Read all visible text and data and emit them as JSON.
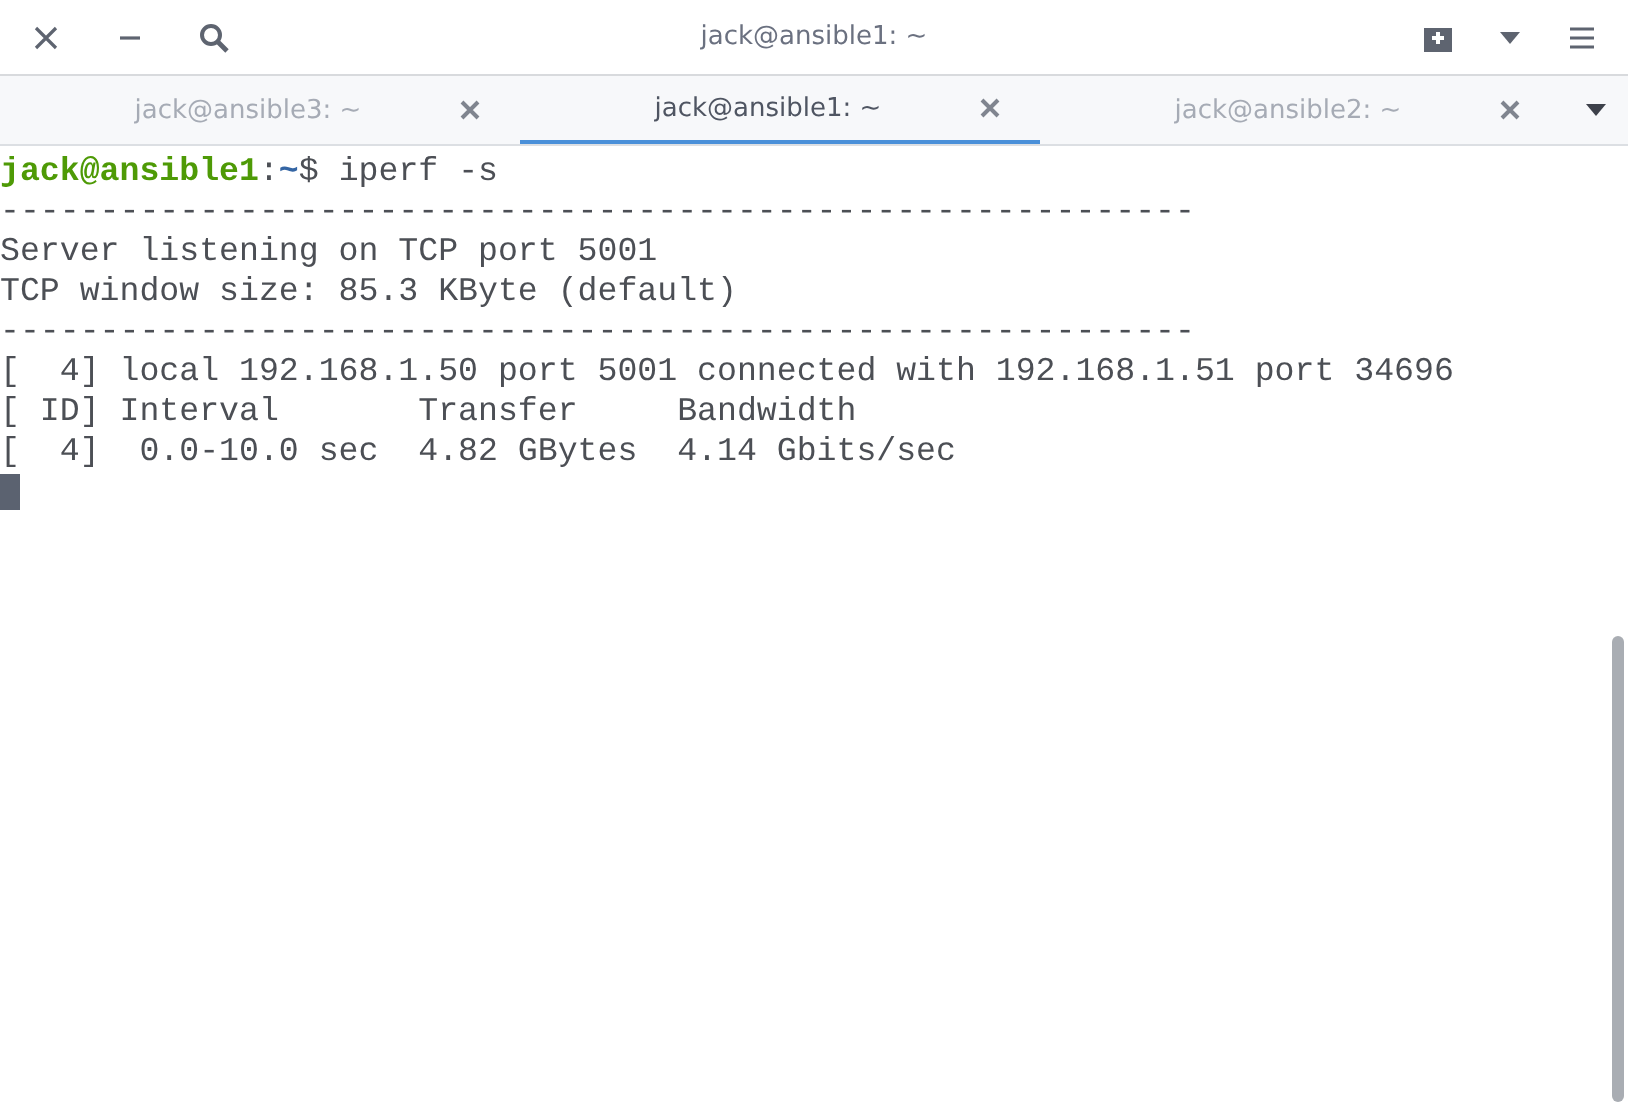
{
  "window": {
    "title": "jack@ansible1: ~"
  },
  "tabs": [
    {
      "label": "jack@ansible3: ~",
      "selected": false
    },
    {
      "label": "jack@ansible1: ~",
      "selected": true
    },
    {
      "label": "jack@ansible2: ~",
      "selected": false
    }
  ],
  "terminal": {
    "lines": [
      {
        "kind": "prompt",
        "user_host": "jack@ansible1",
        "separator": ":",
        "path": "~",
        "symbol": "$",
        "command": "iperf -s"
      },
      {
        "kind": "text",
        "text": "------------------------------------------------------------"
      },
      {
        "kind": "text",
        "text": "Server listening on TCP port 5001"
      },
      {
        "kind": "text",
        "text": "TCP window size: 85.3 KByte (default)"
      },
      {
        "kind": "text",
        "text": "------------------------------------------------------------"
      },
      {
        "kind": "text",
        "text": "[  4] local 192.168.1.50 port 5001 connected with 192.168.1.51 port 34696"
      },
      {
        "kind": "text",
        "text": "[ ID] Interval       Transfer     Bandwidth"
      },
      {
        "kind": "text",
        "text": "[  4]  0.0-10.0 sec  4.82 GBytes  4.14 Gbits/sec"
      },
      {
        "kind": "cursor"
      }
    ]
  }
}
